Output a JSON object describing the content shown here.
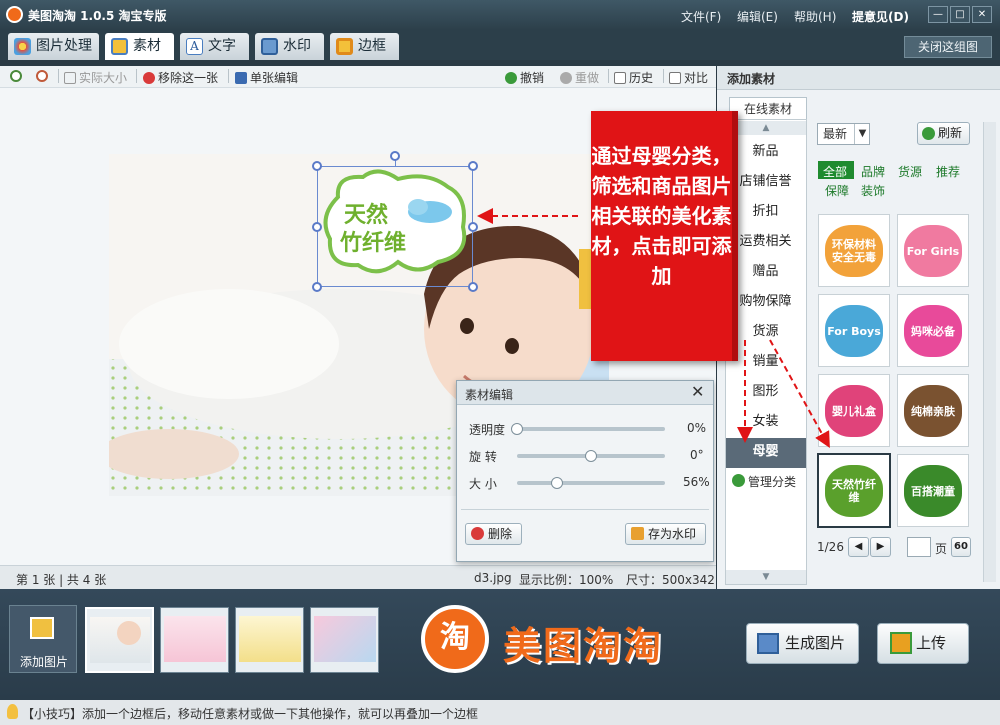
{
  "window": {
    "title": "美图淘淘 1.0.5 淘宝专版",
    "menus": [
      "文件(F)",
      "编辑(E)",
      "帮助(H)",
      "提意见(D)"
    ],
    "controls": [
      "—",
      "□",
      "✕"
    ]
  },
  "tabs": [
    {
      "label": "图片处理",
      "icon": "picture-icon"
    },
    {
      "label": "素材",
      "icon": "material-icon"
    },
    {
      "label": "文字",
      "icon": "text-icon"
    },
    {
      "label": "水印",
      "icon": "watermark-icon"
    },
    {
      "label": "边框",
      "icon": "frame-icon"
    }
  ],
  "close_group_label": "关闭这组图",
  "toolbar": {
    "zoom_in_label": "",
    "zoom_out_label": "",
    "actual_size": "实际大小",
    "remove_this": "移除这一张",
    "single_edit": "单张编辑",
    "undo": "撤销",
    "redo": "重做",
    "history": "历史",
    "compare": "对比"
  },
  "status": {
    "page_info": "第 1 张 | 共 4 张",
    "filename": "d3.jpg",
    "zoom": "显示比例：100%",
    "size": "尺寸：500x342"
  },
  "sticker_on_canvas": {
    "line1": "天然",
    "line2": "竹纤维"
  },
  "right_panel": {
    "title": "添加素材",
    "online_tab": "在线素材",
    "sort_select": "最新",
    "refresh": "刷新",
    "categories": [
      "新品",
      "店铺信誉",
      "折扣",
      "运费相关",
      "赠品",
      "购物保障",
      "货源",
      "销量",
      "图形",
      "女装",
      "母婴"
    ],
    "selected_category": "母婴",
    "manage": "管理分类",
    "filters_row1": [
      "全部",
      "品牌",
      "货源",
      "推荐"
    ],
    "filters_row2": [
      "保障",
      "装饰"
    ],
    "materials": [
      {
        "text": "环保材料安全无毒",
        "color": "#f2a23a"
      },
      {
        "text": "For Girls",
        "color": "#f07aa0"
      },
      {
        "text": "For Boys",
        "color": "#4aa8d8"
      },
      {
        "text": "妈咪必备",
        "color": "#e84a9a"
      },
      {
        "text": "婴儿礼盒",
        "color": "#e0437a"
      },
      {
        "text": "纯棉亲肤",
        "color": "#7a5230"
      },
      {
        "text": "天然竹纤维",
        "color": "#5aa02c"
      },
      {
        "text": "百搭潮童",
        "color": "#3a8a2a"
      }
    ],
    "pager": {
      "current": "1/26",
      "page_label": "页",
      "go": "60"
    }
  },
  "dialog": {
    "title": "素材编辑",
    "sliders": [
      {
        "label": "透明度",
        "value_text": "0%",
        "fraction": 0.0
      },
      {
        "label": "旋 转",
        "value_text": "0°",
        "fraction": 0.5
      },
      {
        "label": "大 小",
        "value_text": "56%",
        "fraction": 0.27
      }
    ],
    "delete": "删除",
    "save_watermark": "存为水印"
  },
  "callout": "通过母婴分类，筛选和商品图片相关联的美化素材，点击即可添加",
  "bottom": {
    "add_image": "添加图片",
    "brand": "美图淘淘",
    "generate": "生成图片",
    "upload": "上传"
  },
  "tip": "【小技巧】添加一个边框后，移动任意素材或做一下其他操作，就可以再叠加一个边框",
  "colors": {
    "accent_green": "#1d7a2a",
    "callout_red": "#e01416",
    "titlebar": "#2c3f4a"
  }
}
